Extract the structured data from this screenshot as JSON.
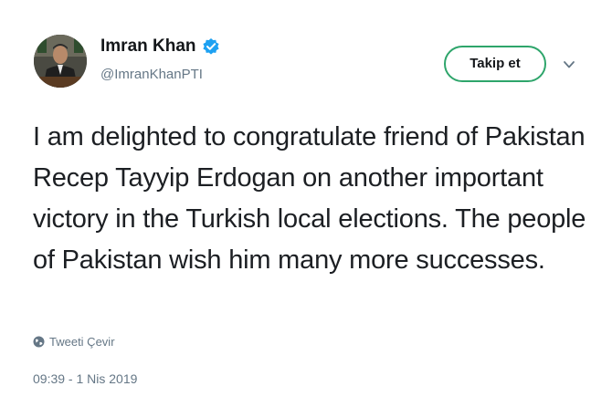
{
  "user": {
    "display_name": "Imran Khan",
    "handle": "@ImranKhanPTI",
    "verified": true
  },
  "actions": {
    "follow_label": "Takip et"
  },
  "icons": {
    "verified": "verified-badge-icon",
    "caret": "chevron-down-icon",
    "globe": "globe-icon"
  },
  "tweet": {
    "text": "I am delighted to congratulate friend of Pakistan Recep Tayyip Erdogan on another important victory in the Turkish local elections. The people of Pakistan wish him many more successes.",
    "translate_label": "Tweeti Çevir",
    "timestamp": "09:39 - 1 Nis 2019"
  },
  "colors": {
    "verified": "#1da1f2",
    "follow_border": "#2ea56b",
    "secondary_text": "#657786"
  }
}
